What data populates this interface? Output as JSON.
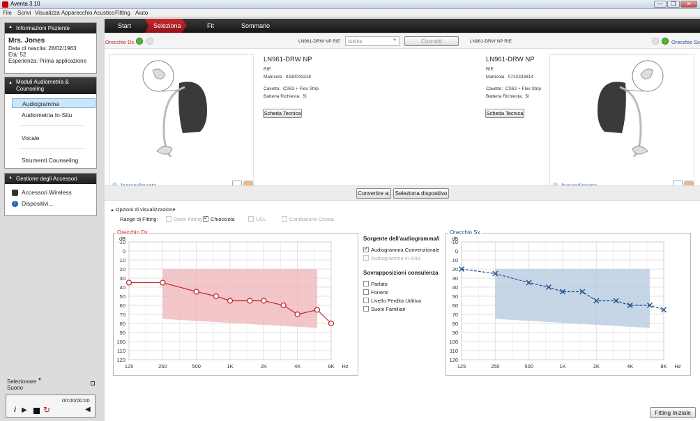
{
  "window": {
    "title": "Aventa 3.10",
    "controls": [
      "—",
      "❐",
      "✕"
    ]
  },
  "menu": [
    "File",
    "Scrivi",
    "Visualizza",
    "Apparecchio Acustico",
    "Fitting",
    "Aiuto"
  ],
  "patient": {
    "header": "Informazioni Paziente",
    "name": "Mrs. Jones",
    "dob": "Data di nascita: 28/02/1963",
    "age": "Età: 52",
    "experience": "Esperienza: Prima applicazione"
  },
  "modules": {
    "header": "Moduli Audiometria & Counseling",
    "items": [
      "Audiogramma",
      "Audiometria In-Situ",
      "Vocale",
      "Strumenti Counseling"
    ]
  },
  "accessories": {
    "header": "Gestione degli Accessori",
    "items": [
      "Accessori Wireless",
      "Dispositivi..."
    ]
  },
  "sound": {
    "label": "Selezionare Suono",
    "time": "00:00/00:00"
  },
  "tabs": [
    "Start",
    "Seleziona",
    "Fit",
    "Sommario"
  ],
  "device_bar": {
    "right_ear": "Orecchio Dx",
    "left_ear": "Orecchio Sx",
    "model_left": "LN961-DRW NP RIE",
    "model_right": "LN961-DRW NP RIE",
    "link_value": "Airlink",
    "connect": "Connetti"
  },
  "device_right": {
    "model": "LN961-DRW NP",
    "style": "RIE",
    "serial_label": "Matricola",
    "serial": "0330043318",
    "cable_label": "Cavetto:",
    "cable": "CS63 + Flex Strip",
    "battery_label": "Batteria Richiesta:",
    "battery": "5I",
    "spec_button": "Scheda Tecnica",
    "zoom": "Ingrandimento"
  },
  "device_left": {
    "model": "LN961-DRW NP",
    "style": "RIE",
    "serial_label": "Matricola",
    "serial": "0742333814",
    "cable_label": "Cavetto:",
    "cable": "CS63 + Flex Strip",
    "battery_label": "Batteria Richiesta:",
    "battery": "5I",
    "spec_button": "Scheda Tecnica",
    "zoom": "Ingrandimento"
  },
  "actions": {
    "convert": "Convertire a:",
    "select_device": "Seleziona dispositivo"
  },
  "display_options": {
    "header": "Opzioni di visualizzazione",
    "range_label": "Range di Fitting:",
    "open_fitting": "Open Fitting",
    "cochlea": "Chiocciola",
    "ucl": "UCL",
    "bone": "Conduzione Ossea"
  },
  "sources": {
    "header": "Sorgente dell'audiogramma/i",
    "conventional": "Audiogramma Convenzionale",
    "insitu": "Audiogramma In-Situ",
    "overlay_header": "Sovrapposizioni consulenza",
    "overlays": [
      "Parlato",
      "Fonemi",
      "Livello Perdita Uditiva",
      "Suoni Familiari"
    ]
  },
  "footer": {
    "initial_fitting": "Fitting Iniziale"
  },
  "colors": {
    "right": "#c0282d",
    "left": "#1f4e8c",
    "right_fill": "#f0b8bc",
    "left_fill": "#b8cce0"
  },
  "chart_data": [
    {
      "type": "line",
      "title": "Orecchio Dx",
      "ylabel": "dB",
      "xlabel": "Hz",
      "x_ticks": [
        "125",
        "250",
        "500",
        "1K",
        "2K",
        "4K",
        "8K"
      ],
      "y_ticks": [
        "-10",
        "0",
        "10",
        "20",
        "30",
        "40",
        "50",
        "60",
        "70",
        "80",
        "90",
        "100",
        "110",
        "120"
      ],
      "ylim": [
        -10,
        120
      ],
      "y_inverted": true,
      "x_scale": "log",
      "grid": true,
      "series": [
        {
          "marker": "circle",
          "color": "#c0282d",
          "x": [
            125,
            250,
            500,
            750,
            1000,
            1500,
            2000,
            3000,
            4000,
            6000,
            8000
          ],
          "y": [
            35,
            35,
            45,
            50,
            55,
            55,
            55,
            60,
            70,
            65,
            80
          ]
        }
      ],
      "fitting_range": {
        "x": [
          250,
          6000
        ],
        "upper": [
          20,
          20
        ],
        "lower": [
          75,
          85
        ]
      }
    },
    {
      "type": "line",
      "title": "Orecchio Sx",
      "ylabel": "dB",
      "xlabel": "Hz",
      "x_ticks": [
        "125",
        "250",
        "500",
        "1K",
        "2K",
        "4K",
        "8K"
      ],
      "y_ticks": [
        "-10",
        "0",
        "10",
        "20",
        "30",
        "40",
        "50",
        "60",
        "70",
        "80",
        "90",
        "100",
        "110",
        "120"
      ],
      "ylim": [
        -10,
        120
      ],
      "y_inverted": true,
      "x_scale": "log",
      "grid": true,
      "series": [
        {
          "marker": "x",
          "color": "#1f4e8c",
          "x": [
            125,
            250,
            500,
            750,
            1000,
            1500,
            2000,
            3000,
            4000,
            6000,
            8000
          ],
          "y": [
            20,
            25,
            35,
            40,
            45,
            45,
            55,
            55,
            60,
            60,
            65
          ]
        }
      ],
      "fitting_range": {
        "x": [
          250,
          6000
        ],
        "upper": [
          20,
          20
        ],
        "lower": [
          75,
          85
        ]
      }
    }
  ]
}
